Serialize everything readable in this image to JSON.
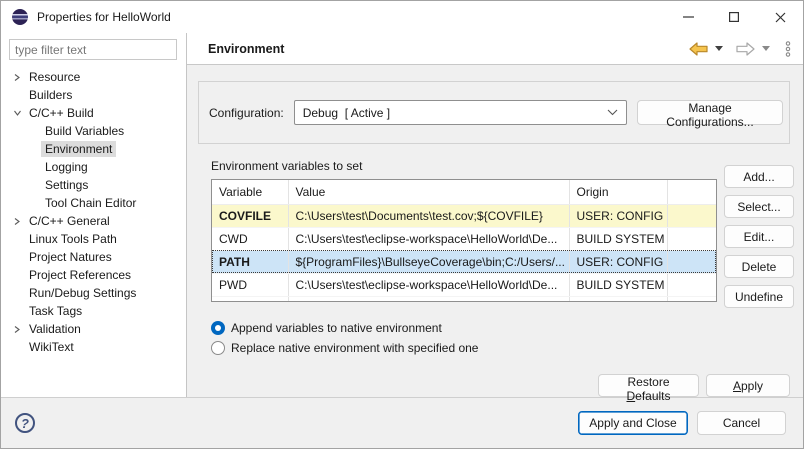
{
  "window": {
    "title": "Properties for HelloWorld"
  },
  "sidebar": {
    "filter_placeholder": "type filter text",
    "items": [
      {
        "label": "Resource",
        "level": 0,
        "chevron": "collapsed",
        "selected": false
      },
      {
        "label": "Builders",
        "level": 0,
        "chevron": "none",
        "selected": false
      },
      {
        "label": "C/C++ Build",
        "level": 0,
        "chevron": "expanded",
        "selected": false
      },
      {
        "label": "Build Variables",
        "level": 1,
        "chevron": "none",
        "selected": false
      },
      {
        "label": "Environment",
        "level": 1,
        "chevron": "none",
        "selected": true
      },
      {
        "label": "Logging",
        "level": 1,
        "chevron": "none",
        "selected": false
      },
      {
        "label": "Settings",
        "level": 1,
        "chevron": "none",
        "selected": false
      },
      {
        "label": "Tool Chain Editor",
        "level": 1,
        "chevron": "none",
        "selected": false
      },
      {
        "label": "C/C++ General",
        "level": 0,
        "chevron": "collapsed",
        "selected": false
      },
      {
        "label": "Linux Tools Path",
        "level": 0,
        "chevron": "none",
        "selected": false
      },
      {
        "label": "Project Natures",
        "level": 0,
        "chevron": "none",
        "selected": false
      },
      {
        "label": "Project References",
        "level": 0,
        "chevron": "none",
        "selected": false
      },
      {
        "label": "Run/Debug Settings",
        "level": 0,
        "chevron": "none",
        "selected": false
      },
      {
        "label": "Task Tags",
        "level": 0,
        "chevron": "none",
        "selected": false
      },
      {
        "label": "Validation",
        "level": 0,
        "chevron": "collapsed",
        "selected": false
      },
      {
        "label": "WikiText",
        "level": 0,
        "chevron": "none",
        "selected": false
      }
    ]
  },
  "header": {
    "title": "Environment"
  },
  "config": {
    "label": "Configuration:",
    "value": "Debug  [ Active ]",
    "manage_button": "Manage Configurations..."
  },
  "env": {
    "table_label": "Environment variables to set",
    "columns": [
      "Variable",
      "Value",
      "Origin"
    ],
    "rows": [
      {
        "variable": "COVFILE",
        "value": "C:\\Users\\test\\Documents\\test.cov;${COVFILE}",
        "origin": "USER: CONFIG",
        "state": "modified"
      },
      {
        "variable": "CWD",
        "value": "C:\\Users\\test\\eclipse-workspace\\HelloWorld\\De...",
        "origin": "BUILD SYSTEM",
        "state": "normal"
      },
      {
        "variable": "PATH",
        "value": "${ProgramFiles}\\BullseyeCoverage\\bin;C:/Users/...",
        "origin": "USER: CONFIG",
        "state": "selected"
      },
      {
        "variable": "PWD",
        "value": "C:\\Users\\test\\eclipse-workspace\\HelloWorld\\De...",
        "origin": "BUILD SYSTEM",
        "state": "normal"
      }
    ],
    "side_buttons": [
      "Add...",
      "Select...",
      "Edit...",
      "Delete",
      "Undefine"
    ],
    "radio_append": "Append variables to native environment",
    "radio_append_selected": true,
    "radio_replace": "Replace native environment with specified one",
    "radio_replace_selected": false
  },
  "footer": {
    "restore_defaults": {
      "pre": "Restore ",
      "mnemonic": "D",
      "post": "efaults"
    },
    "apply": {
      "pre": "",
      "mnemonic": "A",
      "post": "pply"
    },
    "apply_and_close": "Apply and Close",
    "cancel": "Cancel"
  },
  "colors": {
    "accent_blue": "#0067c0",
    "selected_row_bg": "#cde4f7",
    "modified_row_bg": "#fbf8cc",
    "tree_selection_bg": "#dcdcdc",
    "back_arrow_gold": "#f5c44e",
    "help_icon_blue": "#41537f",
    "panel_bg": "#f0f0f0"
  }
}
